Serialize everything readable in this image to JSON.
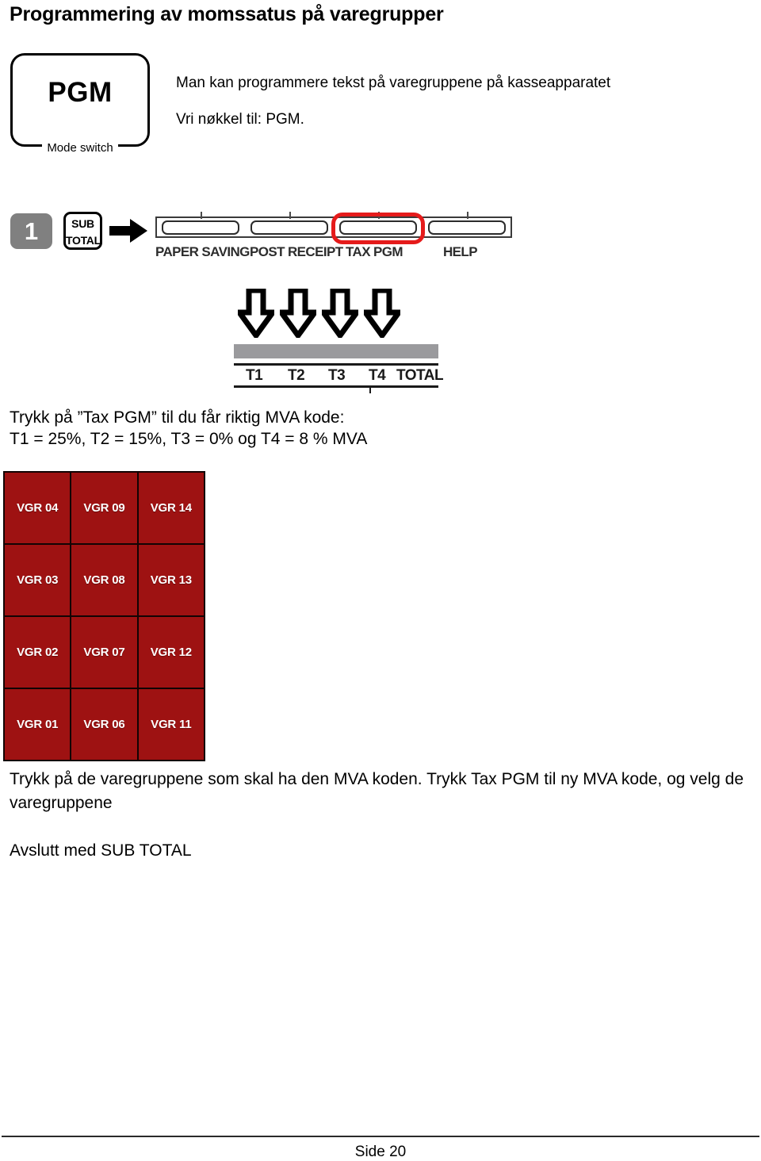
{
  "document": {
    "title": "Programmering av momssatus på varegrupper",
    "footer_page": "Side 20"
  },
  "mode_switch": {
    "value": "PGM",
    "caption": "Mode switch"
  },
  "intro": {
    "line1": "Man kan programmere tekst på varegruppene på kasseapparatet",
    "line2": "Vri nøkkel til: PGM."
  },
  "step_one": {
    "badge": "1",
    "subtotal_key_line1": "SUB",
    "subtotal_key_line2": "TOTAL",
    "arrow_icon": "arrow-right-icon"
  },
  "function_keys": {
    "keys": [
      {
        "label": "PAPER SAVING",
        "highlighted": false
      },
      {
        "label": "POST RECEIPT",
        "highlighted": false
      },
      {
        "label": "TAX PGM",
        "highlighted": true
      },
      {
        "label": "HELP",
        "highlighted": false
      }
    ],
    "highlight_color": "#e51b1b"
  },
  "tax_indicator": {
    "arrow_icon": "arrow-down-outline-icon",
    "arrow_count": 4,
    "bar_color": "#9a9a9d",
    "labels": [
      "T1",
      "T2",
      "T3",
      "T4",
      "TOTAL"
    ]
  },
  "mid_instruction": {
    "line1": "Trykk på ”Tax PGM” til du får riktig MVA kode:",
    "line2": "T1 = 25%, T2 = 15%, T3 = 0% og T4 = 8 % MVA"
  },
  "vgr_keypad": {
    "key_color": "#9e1212",
    "rows": [
      [
        "VGR 04",
        "VGR 09",
        "VGR 14"
      ],
      [
        "VGR 03",
        "VGR 08",
        "VGR 13"
      ],
      [
        "VGR 02",
        "VGR 07",
        "VGR 12"
      ],
      [
        "VGR 01",
        "VGR 06",
        "VGR 11"
      ]
    ]
  },
  "bottom_instruction": {
    "para1": "Trykk på de varegruppene som skal ha den MVA koden. Trykk Tax PGM til ny MVA kode, og velg de varegruppene",
    "para2": "Avslutt med SUB TOTAL"
  }
}
